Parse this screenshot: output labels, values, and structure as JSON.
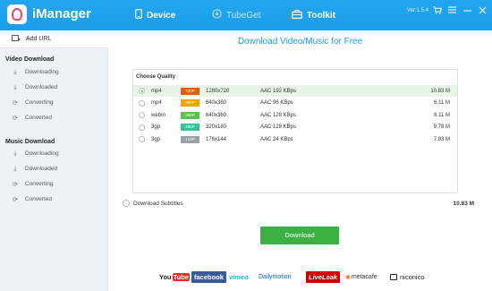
{
  "header": {
    "app_name": "iManager",
    "nav": [
      {
        "label": "Device",
        "icon": "phone-icon"
      },
      {
        "label": "TubeGet",
        "icon": "download-circle-icon"
      },
      {
        "label": "Toolkit",
        "icon": "toolbox-icon"
      }
    ],
    "version": "Ver:1.5.4"
  },
  "sidebar": {
    "add_url": "Add URL",
    "video_section": "Video Download",
    "video_items": [
      "Downloading",
      "Downloaded",
      "Converting",
      "Converted"
    ],
    "music_section": "Music Download",
    "music_items": [
      "Downloading",
      "Downloaded",
      "Converting",
      "Converted"
    ]
  },
  "main": {
    "title": "Download Video/Music for Free",
    "choose_quality": "Choose Quality",
    "qualities": [
      {
        "format": "mp4",
        "badge": "720P",
        "badge_color": "#e05a1e",
        "resolution": "1280x720",
        "audio": "AAC 192 KBps",
        "size": "10.83 M",
        "selected": true
      },
      {
        "format": "mp4",
        "badge": "360P",
        "badge_color": "#f0a500",
        "resolution": "640x360",
        "audio": "AAC 96 KBps",
        "size": "6.11 M",
        "selected": false
      },
      {
        "format": "webm",
        "badge": "360P",
        "badge_color": "#5cc04c",
        "resolution": "640x360",
        "audio": "AAC 128 KBps",
        "size": "6.11 M",
        "selected": false
      },
      {
        "format": "3gp",
        "badge": "180P",
        "badge_color": "#3dbf9a",
        "resolution": "320x180",
        "audio": "AAC 128 KBps",
        "size": "9.78 M",
        "selected": false
      },
      {
        "format": "3gp",
        "badge": "144P",
        "badge_color": "#9aa0a6",
        "resolution": "176x144",
        "audio": "AAC 24 KBps",
        "size": "7.83 M",
        "selected": false
      }
    ],
    "subtitles_label": "Download Subtitles",
    "total_size": "10.83 M",
    "download_button": "Download"
  },
  "brands": {
    "youtube_you": "You",
    "youtube_tube": "Tube",
    "facebook": "facebook",
    "vimeo": "vimeo",
    "dailymotion": "Dailymotion",
    "liveleak": "LiveLeak",
    "metacafe": "metacafe",
    "niconico": "niconico"
  },
  "colors": {
    "header": "#1da1f2",
    "accent": "#1d9be4",
    "download_button": "#3cb043",
    "selected_row": "#e6f5e6"
  }
}
